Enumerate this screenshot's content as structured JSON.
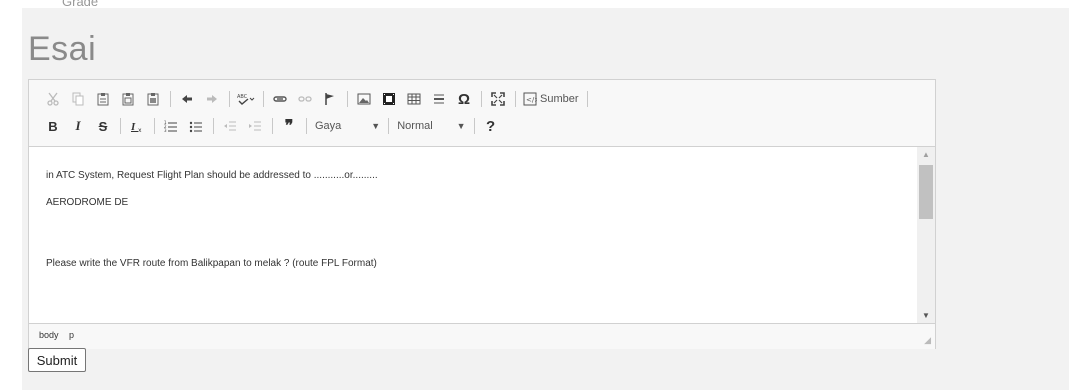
{
  "cut_text": "Grade",
  "section_title": "Esai",
  "toolbar": {
    "row1": [
      {
        "icon": "cut-icon",
        "glyph": "✂"
      },
      {
        "icon": "copy-icon",
        "glyph": "⎘"
      },
      {
        "icon": "paste-icon",
        "glyph": "📋"
      },
      {
        "icon": "paste-text-icon",
        "glyph": "📋"
      },
      {
        "icon": "paste-word-icon",
        "glyph": "📋"
      },
      {
        "icon": "undo-icon",
        "glyph": "↶"
      },
      {
        "icon": "redo-icon",
        "glyph": "↷"
      },
      {
        "icon": "spellcheck-icon",
        "glyph": "ᴬᴮᶜ"
      },
      {
        "icon": "link-icon",
        "glyph": "⊂⊃"
      },
      {
        "icon": "unlink-icon",
        "glyph": "⊂⊃"
      },
      {
        "icon": "anchor-flag-icon",
        "glyph": "⚑"
      },
      {
        "icon": "image-icon",
        "glyph": "▭"
      },
      {
        "icon": "video-icon",
        "glyph": "▮"
      },
      {
        "icon": "table-icon",
        "glyph": "▦"
      },
      {
        "icon": "horizontal-line-icon",
        "glyph": "≡"
      },
      {
        "icon": "special-char-icon",
        "glyph": "Ω"
      },
      {
        "icon": "maximize-icon",
        "glyph": "⛶"
      },
      {
        "icon": "source-icon",
        "glyph": "▣"
      }
    ],
    "source_label": "Sumber",
    "row2": {
      "bold": "B",
      "italic": "I",
      "strike": "S",
      "remove_format": "Ix",
      "style_combo": "Gaya",
      "format_combo": "Normal",
      "help": "?"
    }
  },
  "content": {
    "line1": "in ATC System, Request Flight Plan should be addressed to ...........or.........",
    "line2": "AERODROME DE",
    "line3": "Please write the VFR route from Balikpapan to melak ? (route FPL Format)"
  },
  "status": {
    "path": [
      "body",
      "p"
    ]
  },
  "submit_label": "Submit"
}
